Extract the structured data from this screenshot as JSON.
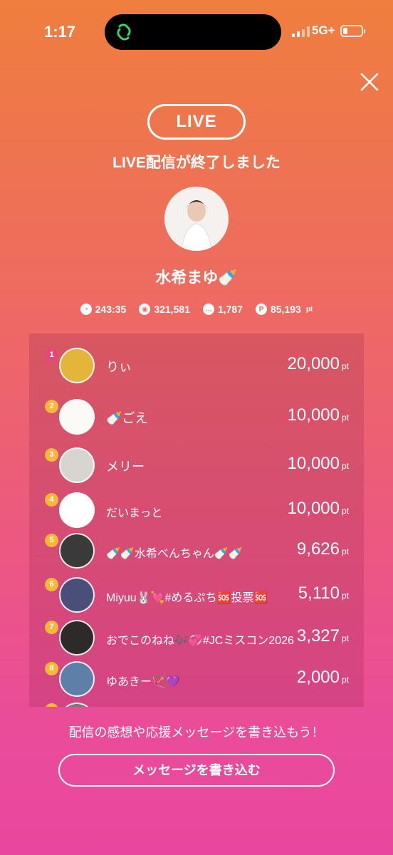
{
  "status_bar": {
    "time": "1:17",
    "network": "5G+"
  },
  "header": {
    "live_label": "LIVE",
    "ended_message": "LIVE配信が終了しました"
  },
  "host": {
    "name": "水希まゆ🍼"
  },
  "stats": {
    "duration": "243:35",
    "views": "321,581",
    "comments": "1,787",
    "points": "85,193",
    "points_unit": "pt"
  },
  "ranking": [
    {
      "rank": "1",
      "name": "りぃ",
      "points": "20,000",
      "unit": "pt"
    },
    {
      "rank": "2",
      "name": "🍼ごえ",
      "points": "10,000",
      "unit": "pt"
    },
    {
      "rank": "3",
      "name": "メリー",
      "points": "10,000",
      "unit": "pt"
    },
    {
      "rank": "4",
      "name": "だいまっと",
      "points": "10,000",
      "unit": "pt"
    },
    {
      "rank": "5",
      "name": "🍼🍼水希べんちゃん🍼🍼",
      "points": "9,626",
      "unit": "pt"
    },
    {
      "rank": "6",
      "name": "Miyuu🐰💘#めるぷち🆘投票🆘",
      "points": "5,110",
      "unit": "pt"
    },
    {
      "rank": "7",
      "name": "おでこのねね🎶💞#JCミスコン2026",
      "points": "3,327",
      "unit": "pt"
    },
    {
      "rank": "8",
      "name": "ゆあきー🏹💜",
      "points": "2,000",
      "unit": "pt"
    }
  ],
  "footer": {
    "prompt": "配信の感想や応援メッセージを書き込もう！",
    "button_label": "メッセージを書き込む"
  },
  "colors": {
    "rank_first": "#e8457a",
    "rank_other": "#f6b83a"
  }
}
